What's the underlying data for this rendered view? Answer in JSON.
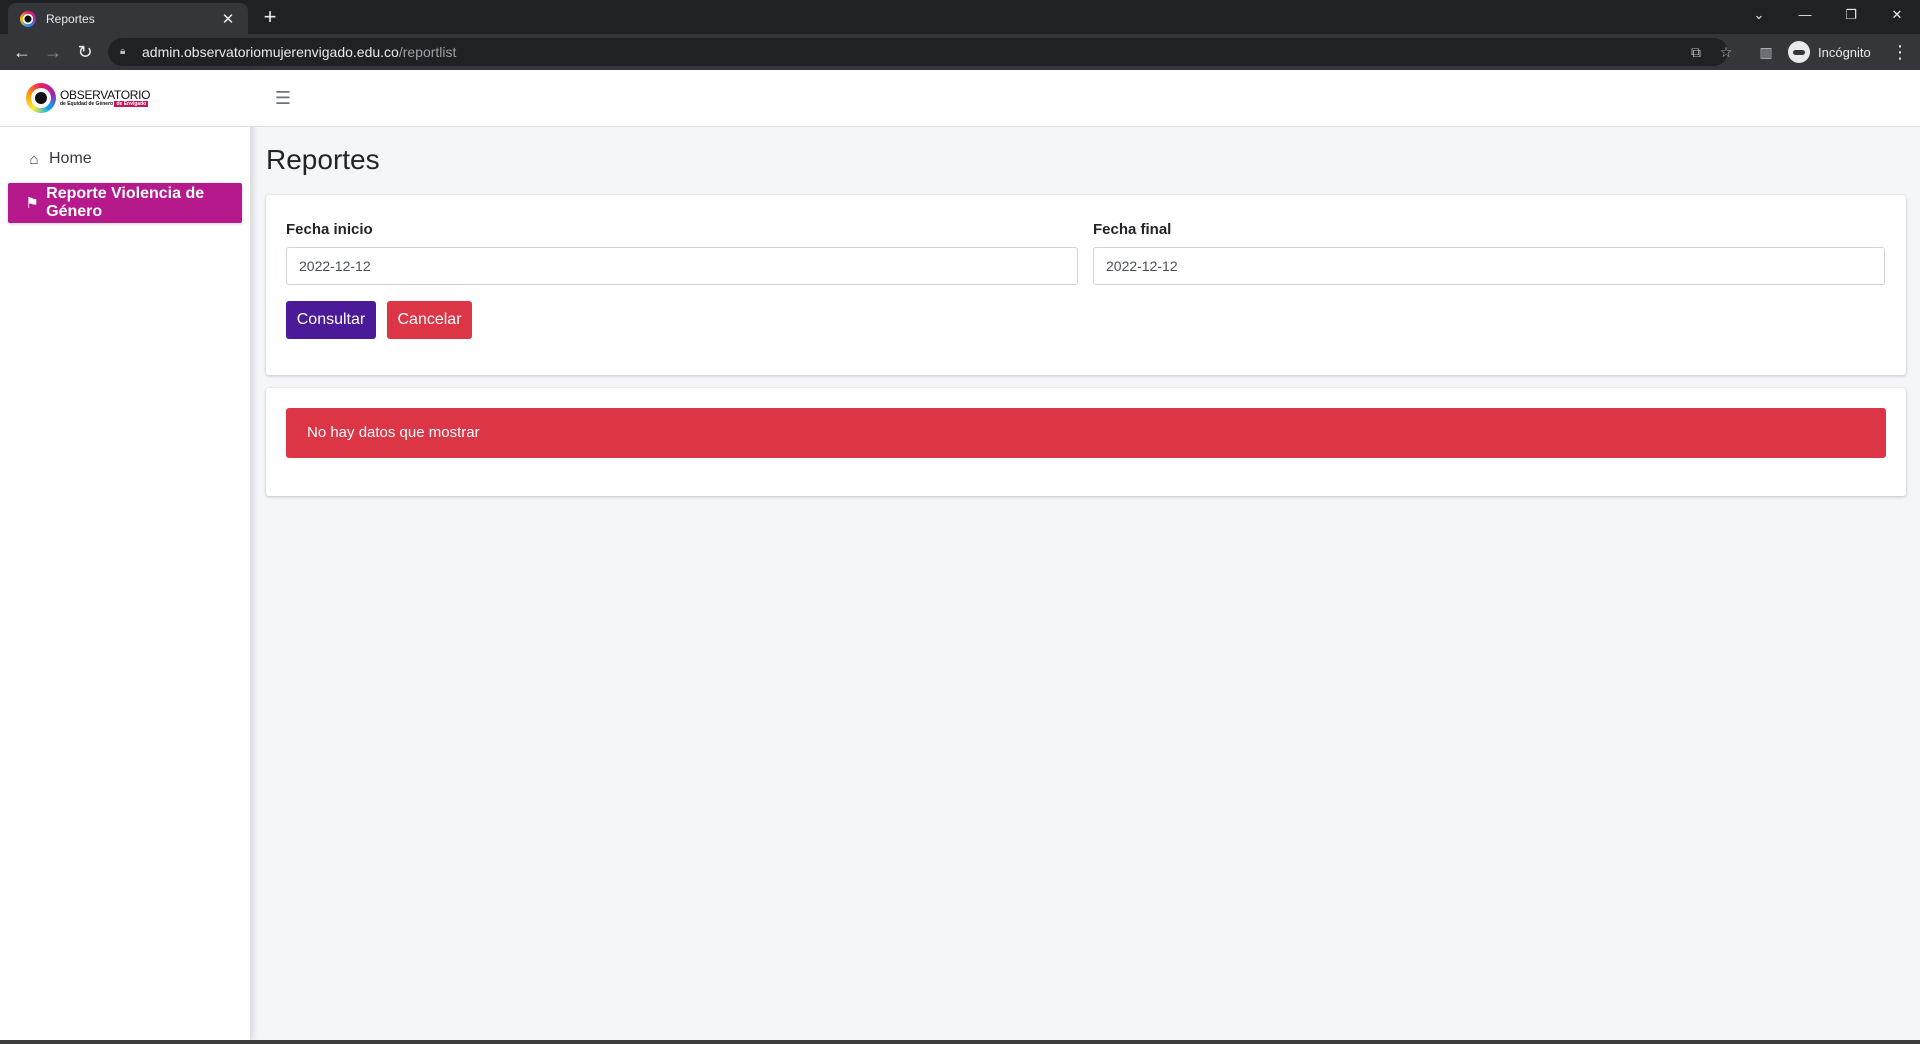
{
  "browser": {
    "tab_title": "Reportes",
    "tab_close": "✕",
    "new_tab": "+",
    "url_host": "admin.observatoriomujerenvigado.edu.co",
    "url_path": "/reportlist",
    "profile_label": "Incógnito"
  },
  "sidebar": {
    "logo_title": "OBSERVATORIO",
    "logo_subtitle": "de Equidad de Género",
    "logo_subtitle_tag": "de Envigado",
    "items": [
      {
        "label": "Home",
        "icon": "home-icon",
        "active": false
      },
      {
        "label": "Reporte Violencia de Género",
        "icon": "flag-checkered-icon",
        "active": true
      }
    ]
  },
  "main": {
    "title": "Reportes",
    "form": {
      "start_label": "Fecha inicio",
      "start_value": "2022-12-12",
      "end_label": "Fecha final",
      "end_value": "2022-12-12",
      "submit_label": "Consultar",
      "cancel_label": "Cancelar"
    },
    "alert_text": "No hay datos que mostrar"
  },
  "colors": {
    "sidebar_active": "#b5198b",
    "primary_button": "#4a1a99",
    "danger": "#dc3545",
    "page_bg": "#f4f6f9"
  }
}
